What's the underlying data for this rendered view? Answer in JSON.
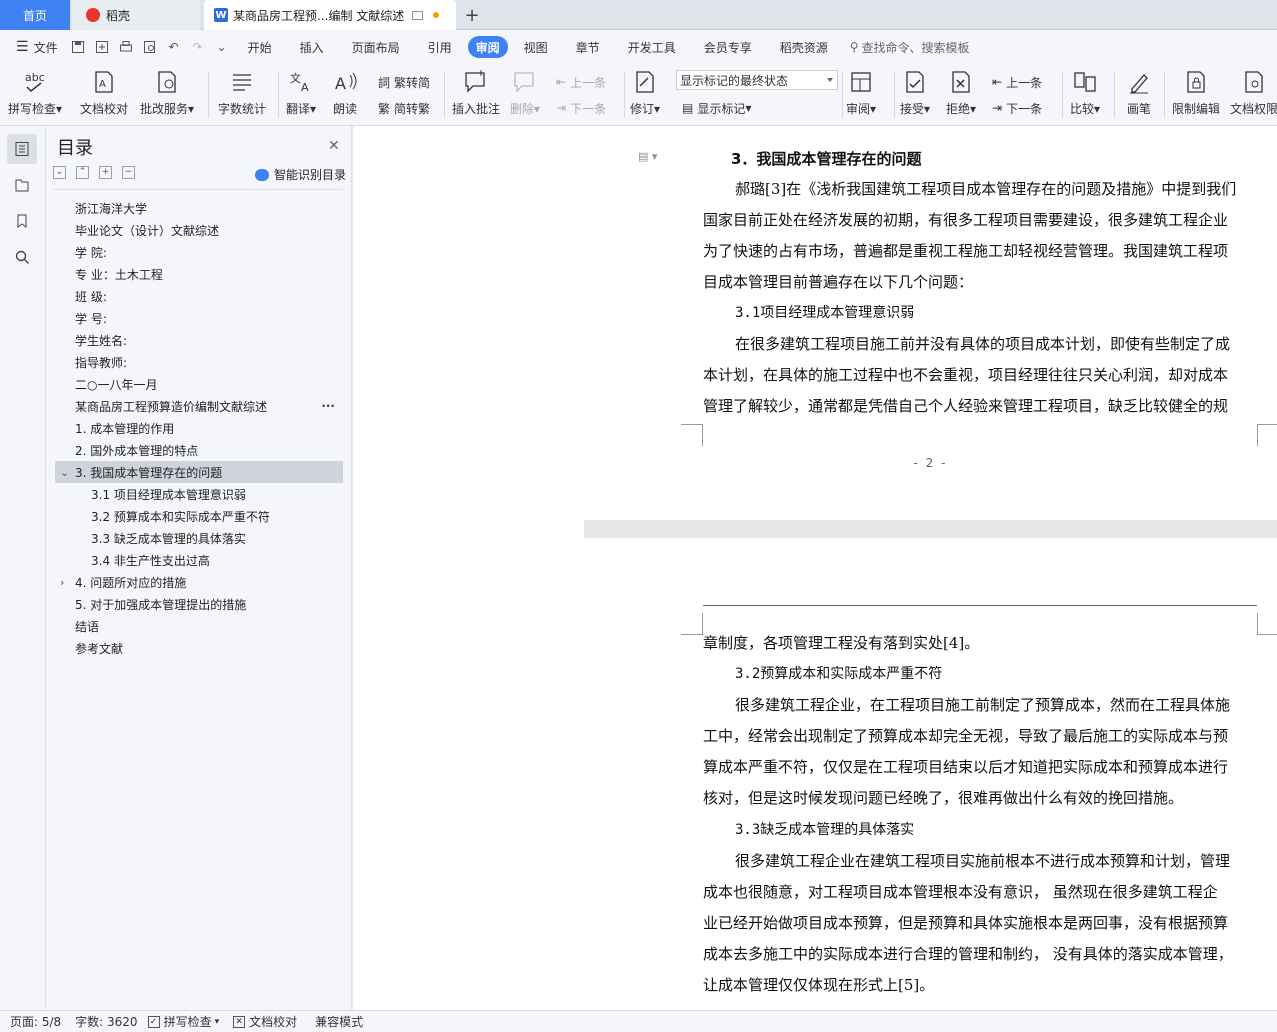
{
  "tabs": {
    "home": "首页",
    "daoke": "稻壳",
    "doc": "某商品房工程预...编制 文献综述"
  },
  "menu": {
    "file": "文件",
    "items": [
      "开始",
      "插入",
      "页面布局",
      "引用",
      "审阅",
      "视图",
      "章节",
      "开发工具",
      "会员专享",
      "稻壳资源"
    ],
    "active_index": 4,
    "search": "查找命令、搜索模板"
  },
  "ribbon": {
    "spell": "拼写检查",
    "doc_check": "文档校对",
    "revise_service": "批改服务",
    "word_count": "字数统计",
    "translate": "翻译",
    "read_aloud": "朗读",
    "trad": "繁转简",
    "simp": "简转繁",
    "insert_comment": "插入批注",
    "delete": "删除",
    "prev": "上一条",
    "next": "下一条",
    "track": "修订",
    "markup_state": "显示标记的最终状态",
    "show_markup": "显示标记",
    "review": "审阅",
    "accept": "接受",
    "reject": "拒绝",
    "prev2": "上一条",
    "next2": "下一条",
    "compare": "比较",
    "pen": "画笔",
    "restrict": "限制编辑",
    "doc_perm": "文档权限"
  },
  "toc": {
    "title": "目录",
    "smart": "智能识别目录",
    "items": [
      {
        "text": "浙江海洋大学",
        "level": 1
      },
      {
        "text": "毕业论文（设计）文献综述",
        "level": 1
      },
      {
        "text": "学      院:",
        "level": 1
      },
      {
        "text": "专      业：土木工程",
        "level": 1
      },
      {
        "text": "班      级:",
        "level": 1
      },
      {
        "text": "学      号:",
        "level": 1
      },
      {
        "text": "学生姓名:",
        "level": 1
      },
      {
        "text": "指导教师:",
        "level": 1
      },
      {
        "text": "二○一八年一月",
        "level": 1
      },
      {
        "text": "某商品房工程预算造价编制文献综述",
        "level": 1
      },
      {
        "text": "1. 成本管理的作用",
        "level": 1
      },
      {
        "text": "2. 国外成本管理的特点",
        "level": 1
      },
      {
        "text": "3. 我国成本管理存在的问题",
        "level": 1
      },
      {
        "text": "3.1 项目经理成本管理意识弱",
        "level": 2
      },
      {
        "text": "3.2 预算成本和实际成本严重不符",
        "level": 2
      },
      {
        "text": "3.3 缺乏成本管理的具体落实",
        "level": 2
      },
      {
        "text": "3.4  非生产性支出过高",
        "level": 2
      },
      {
        "text": "4. 问题所对应的措施",
        "level": 1
      },
      {
        "text": "5. 对于加强成本管理提出的措施",
        "level": 1
      },
      {
        "text": "结语",
        "level": 1
      },
      {
        "text": "参考文献",
        "level": 1
      }
    ]
  },
  "page1": {
    "lines": [
      "3．我国成本管理存在的问题",
      "郝璐[3]在《浅析我国建筑工程项目成本管理存在的问题及措施》中提到我们",
      "国家目前正处在经济发展的初期，有很多工程项目需要建设，很多建筑工程企业",
      "为了快速的占有市场，普遍都是重视工程施工却轻视经营管理。我国建筑工程项",
      "目成本管理目前普遍存在以下几个问题：",
      "3.1项目经理成本管理意识弱",
      "在很多建筑工程项目施工前并没有具体的项目成本计划，即使有些制定了成",
      "本计划，在具体的施工过程中也不会重视，项目经理往往只关心利润，却对成本",
      "管理了解较少，通常都是凭借自己个人经验来管理工程项目，缺乏比较健全的规"
    ],
    "page_number": "- 2 -"
  },
  "page2": {
    "lines": [
      "章制度，各项管理工程没有落到实处[4]。",
      "3.2预算成本和实际成本严重不符",
      "很多建筑工程企业，在工程项目施工前制定了预算成本，然而在工程具体施",
      "工中，经常会出现制定了预算成本却完全无视，导致了最后施工的实际成本与预",
      "算成本严重不符，仅仅是在工程项目结束以后才知道把实际成本和预算成本进行",
      "核对，但是这时候发现问题已经晚了，很难再做出什么有效的挽回措施。",
      "3.3缺乏成本管理的具体落实",
      "很多建筑工程企业在建筑工程项目实施前根本不进行成本预算和计划，管理",
      "成本也很随意，对工程项目成本管理根本没有意识，  虽然现在很多建筑工程企",
      "业已经开始做项目成本预算，但是预算和具体实施根本是两回事，没有根据预算",
      "成本去多施工中的实际成本进行合理的管理和制约，  没有具体的落实成本管理，",
      "让成本管理仅仅体现在形式上[5]。"
    ]
  },
  "status": {
    "page": "页面: 5/8",
    "words": "字数: 3620",
    "spell": "拼写检查",
    "doc_check": "文档校对",
    "compat": "兼容模式"
  },
  "colors": {
    "accent": "#3f82f4",
    "tabbar": "#dfe3ea",
    "panel": "#f4f6f9"
  }
}
